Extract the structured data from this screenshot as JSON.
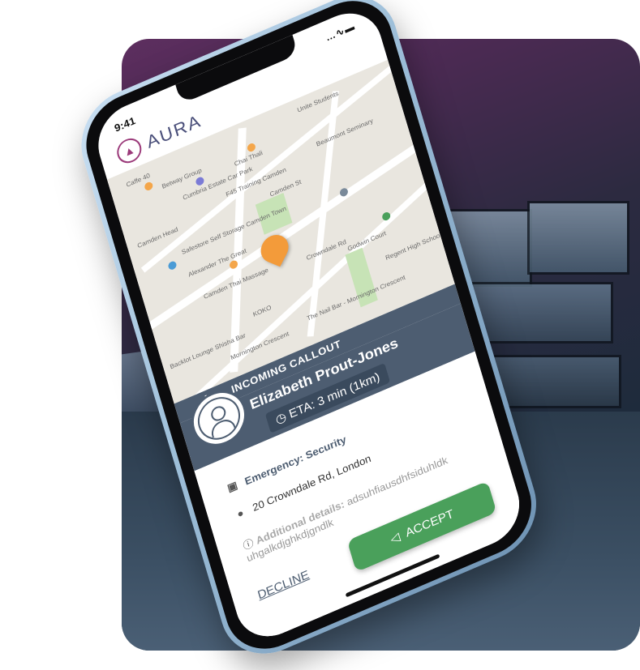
{
  "status_bar": {
    "time": "9:41",
    "icons": "…∿▬"
  },
  "app": {
    "brand": "AURA"
  },
  "map": {
    "labels": [
      "Caffe 40",
      "Betway Group",
      "Cumbria Estate Car Park",
      "Chai Thali",
      "F45 Training Camden",
      "Camden Head",
      "Safestore Self Storage Camden Town",
      "Alexander The Great",
      "Camden Thai Massage",
      "KOKO",
      "Mornington Crescent",
      "Crowndale Rd",
      "Camden St",
      "Regent High School",
      "Godwin Court",
      "Unite Students",
      "Beaumont Seminary",
      "The Nail Bar - Mornington Crescent",
      "Backlot Lounge Shisha Bar"
    ]
  },
  "callout": {
    "header": "INCOMING CALLOUT",
    "caller_name": "Elizabeth Prout-Jones",
    "eta": "ETA: 3 min (1km)",
    "emergency": "Emergency: Security",
    "address": "20 Crowndale Rd, London",
    "additional_label": "Additional details:",
    "additional_value": "adsuhfiausdhfsiduhldk uhgalkdjghkdjgndlk",
    "accept_label": "ACCEPT",
    "decline_label": "DECLINE"
  },
  "colors": {
    "accent": "#4d5d71",
    "accept": "#4aa05b",
    "pin": "#f39b3a",
    "brand": "#9b3a7a"
  }
}
